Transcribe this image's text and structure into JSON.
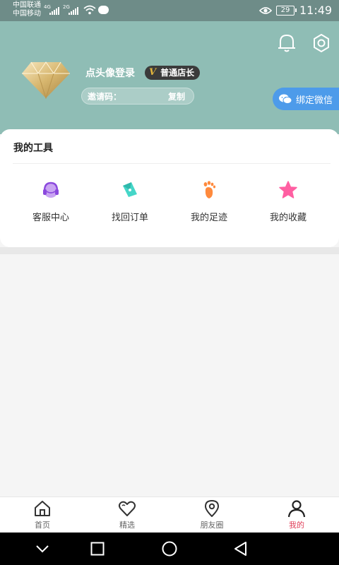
{
  "status_bar": {
    "carrier1": "中国联通",
    "carrier2": "中国移动",
    "net1": "4G",
    "net2": "2G",
    "battery": "29",
    "time": "11:49"
  },
  "header": {
    "login_text": "点头像登录",
    "level_badge_mark": "V",
    "level_badge_label": "普通店长",
    "invite_label": "邀请码：",
    "copy_label": "复制",
    "bind_wechat_label": "绑定微信"
  },
  "tools_card": {
    "title": "我的工具",
    "items": [
      {
        "label": "客服中心",
        "icon": "headset-icon"
      },
      {
        "label": "找回订单",
        "icon": "compass-icon"
      },
      {
        "label": "我的足迹",
        "icon": "footprint-icon"
      },
      {
        "label": "我的收藏",
        "icon": "star-icon"
      }
    ]
  },
  "tabbar": {
    "tabs": [
      {
        "label": "首页",
        "icon": "home-icon"
      },
      {
        "label": "精选",
        "icon": "heart-icon"
      },
      {
        "label": "朋友圈",
        "icon": "location-pin-icon"
      },
      {
        "label": "我的",
        "icon": "person-icon",
        "active": true
      }
    ]
  },
  "colors": {
    "header_bg": "#8fbdb5",
    "statusbar_bg": "#6e8c88",
    "wechat_button": "#4d9bea",
    "active_tab": "#e0405a"
  }
}
